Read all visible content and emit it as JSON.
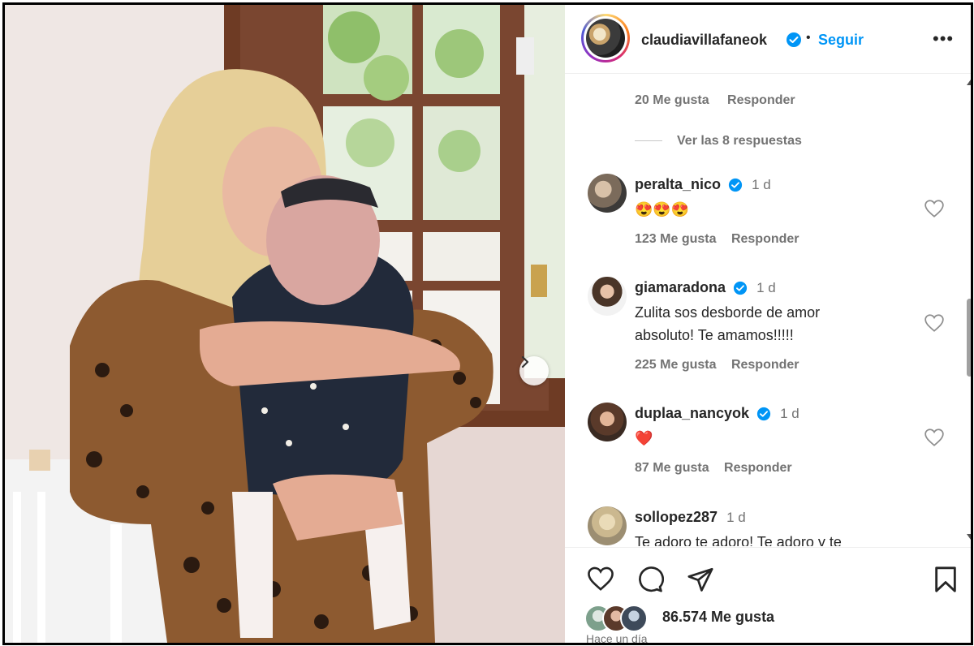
{
  "post": {
    "author": "claudiavillafaneok",
    "follow_label": "Seguir",
    "separator": "•",
    "more_label": "•••"
  },
  "comments_panel": {
    "partial_comment": {
      "likes": "20 Me gusta",
      "reply": "Responder"
    },
    "view_replies": "Ver las 8 respuestas",
    "comments": [
      {
        "user": "peralta_nico",
        "time": "1 d",
        "text": "😍😍😍",
        "likes": "123 Me gusta",
        "reply": "Responder"
      },
      {
        "user": "giamaradona",
        "time": "1 d",
        "text": "Zulita sos desborde de amor absoluto! Te amamos!!!!!",
        "likes": "225 Me gusta",
        "reply": "Responder"
      },
      {
        "user": "duplaa_nancyok",
        "time": "1 d",
        "text": "❤️",
        "likes": "87 Me gusta",
        "reply": "Responder"
      },
      {
        "user": "sollopez287",
        "time": "1 d",
        "text": "Te adoro te adoro! Te adoro y te",
        "likes": "",
        "reply": ""
      }
    ]
  },
  "footer": {
    "likes_count": "86.574 Me gusta",
    "timestamp": "Hace un día"
  },
  "colors": {
    "link_blue": "#0095f6",
    "verified_blue": "#0095f6",
    "text": "#262626",
    "muted": "#737373"
  },
  "icons": [
    "verified-icon",
    "more-icon",
    "heart-icon",
    "comment-icon",
    "share-icon",
    "bookmark-icon",
    "chevron-right-icon"
  ]
}
